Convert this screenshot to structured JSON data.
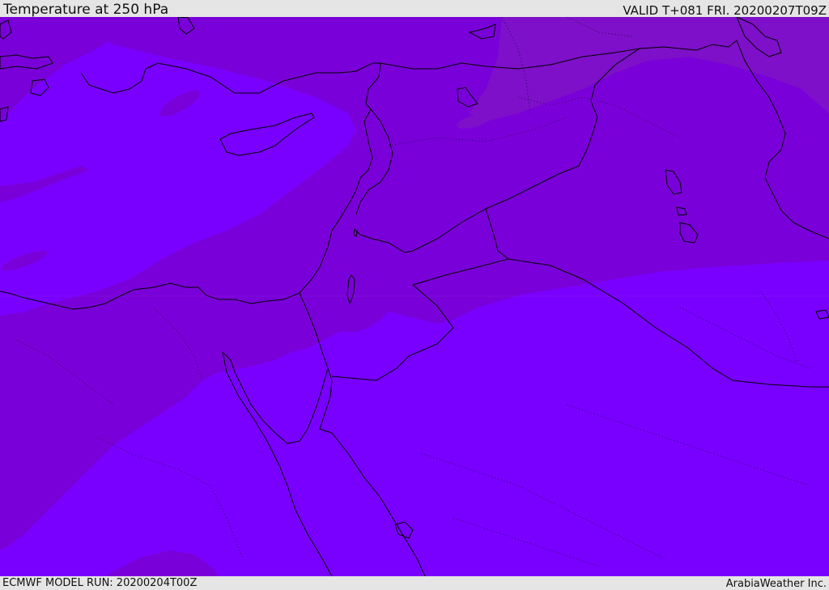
{
  "header": {
    "title": "Temperature at 250 hPa",
    "valid": "VALID T+081 FRI. 20200207T09Z"
  },
  "footer": {
    "model_run": "ECMWF MODEL RUN: 20200204T00Z",
    "credit": "ArabiaWeather Inc."
  },
  "map": {
    "fill_colors": {
      "warm_band": "#7a00d9",
      "cold_band": "#7900ff",
      "warmest_band": "#7d10c8"
    },
    "line_colors": {
      "coastline": "#000000",
      "border": "#000000"
    }
  }
}
